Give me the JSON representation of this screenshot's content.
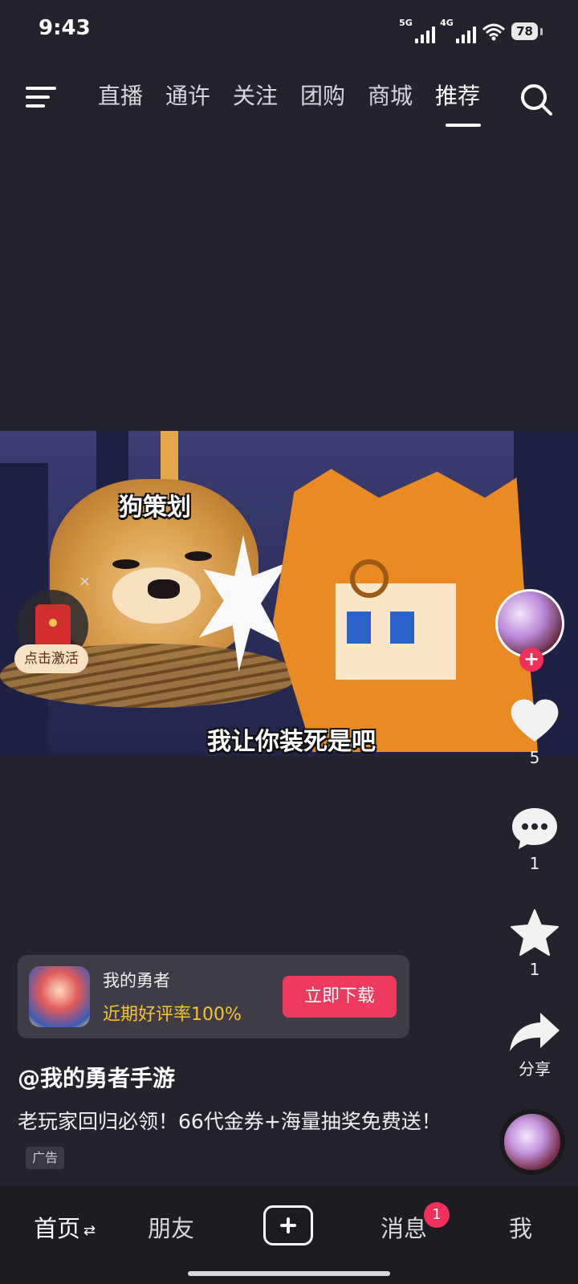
{
  "status_bar": {
    "time": "9:43",
    "net1": "5G",
    "net2": "4G",
    "battery": "78"
  },
  "top_nav": {
    "tabs": [
      {
        "label": "直播"
      },
      {
        "label": "通许"
      },
      {
        "label": "关注"
      },
      {
        "label": "团购"
      },
      {
        "label": "商城"
      },
      {
        "label": "推荐"
      }
    ],
    "active_tab": "推荐",
    "icons": {
      "menu": "menu-icon",
      "search": "search-icon"
    }
  },
  "video": {
    "caption_top": "狗策划",
    "caption_bottom": "我让你装死是吧"
  },
  "red_packet": {
    "label": "点击激活",
    "close": "×"
  },
  "right_rail": {
    "like_count": "5",
    "comment_count": "1",
    "favorite_count": "1",
    "share_label": "分享",
    "follow": "+"
  },
  "ad": {
    "app_name": "我的勇者",
    "rating_text": "近期好评率100%",
    "cta_label": "立即下载"
  },
  "post": {
    "author": "@我的勇者手游",
    "description": "老玩家回归必领！66代金券+海量抽奖免费送！",
    "ad_tag": "广告"
  },
  "bottom_nav": {
    "home": "首页",
    "friends": "朋友",
    "messages": "消息",
    "messages_badge": "1",
    "me": "我",
    "swap_icon": "⇄"
  },
  "colors": {
    "accent": "#ee3a5c",
    "rating": "#f4c431",
    "background": "#26222d"
  }
}
